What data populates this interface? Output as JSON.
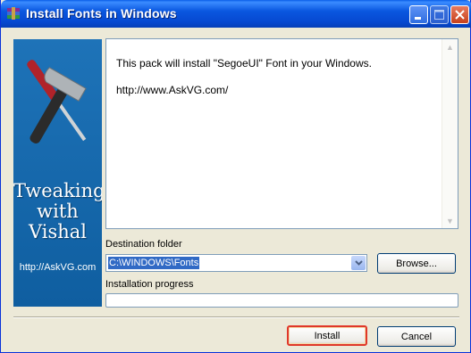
{
  "window": {
    "title": "Install Fonts in Windows"
  },
  "sidebar": {
    "line1": "Tweaking",
    "line2": "with",
    "line3": "Vishal",
    "url": "http://AskVG.com"
  },
  "info": {
    "line1": "This pack will install \"SegoeUI\" Font in your Windows.",
    "line2": "http://www.AskVG.com/"
  },
  "destination": {
    "label": "Destination folder",
    "value": "C:\\WINDOWS\\Fonts",
    "browse_label": "Browse..."
  },
  "progress": {
    "label": "Installation progress",
    "value": 0
  },
  "buttons": {
    "install": "Install",
    "cancel": "Cancel"
  },
  "colors": {
    "titlebar": "#0a57e0",
    "sidebar": "#1e73b8",
    "highlight": "#e0382a"
  }
}
